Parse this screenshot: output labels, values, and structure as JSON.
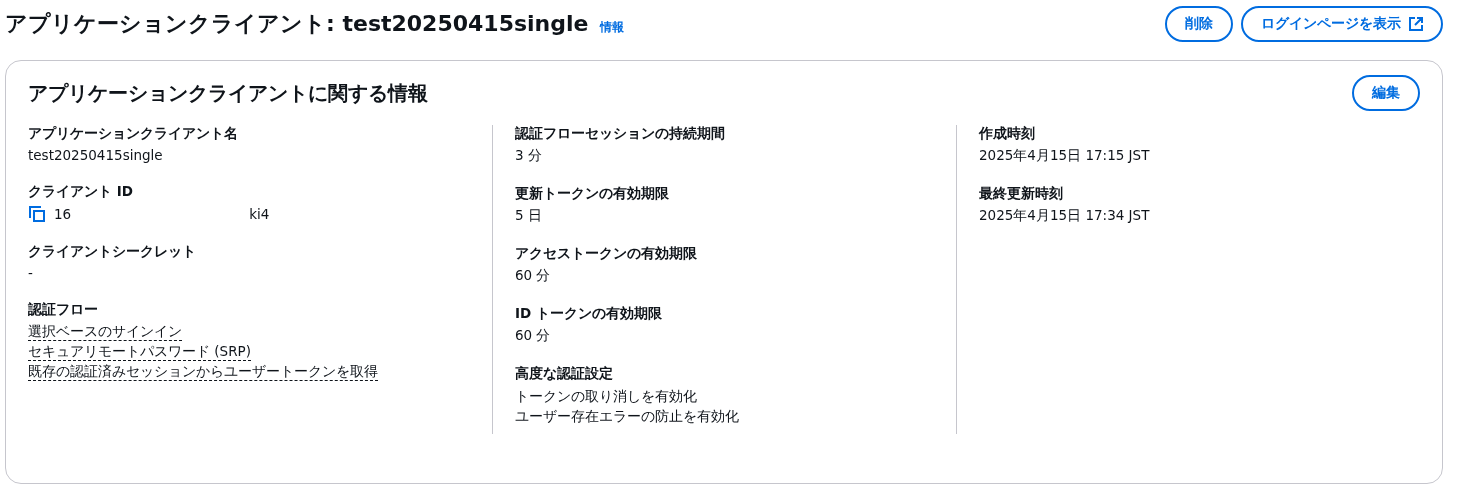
{
  "header": {
    "title": "アプリケーションクライアント: test20250415single",
    "info_link": "情報",
    "buttons": [
      {
        "label": "削除",
        "external": false
      },
      {
        "label": "ログインページを表示",
        "external": true
      }
    ]
  },
  "card": {
    "title": "アプリケーションクライアントに関する情報",
    "edit_button": "編集",
    "columns": [
      {
        "items": [
          {
            "kind": "text",
            "label": "アプリケーションクライアント名",
            "value": "test20250415single"
          },
          {
            "kind": "copy",
            "label": "クライアント ID",
            "value_start": "16",
            "value_end": "ki4"
          },
          {
            "kind": "text",
            "label": "クライアントシークレット",
            "value": "-"
          },
          {
            "kind": "links",
            "label": "認証フロー",
            "values": [
              "選択ベースのサインイン",
              "セキュアリモートパスワード (SRP)",
              "既存の認証済みセッションからユーザートークンを取得"
            ]
          }
        ]
      },
      {
        "items": [
          {
            "kind": "text",
            "label": "認証フローセッションの持続期間",
            "value": "3 分"
          },
          {
            "kind": "text",
            "label": "更新トークンの有効期限",
            "value": "5 日"
          },
          {
            "kind": "text",
            "label": "アクセストークンの有効期限",
            "value": "60 分"
          },
          {
            "kind": "text",
            "label": "ID トークンの有効期限",
            "value": "60 分"
          },
          {
            "kind": "lines",
            "label": "高度な認証設定",
            "values": [
              "トークンの取り消しを有効化",
              "ユーザー存在エラーの防止を有効化"
            ]
          }
        ]
      },
      {
        "items": [
          {
            "kind": "text",
            "label": "作成時刻",
            "value": "2025年4月15日 17:15 JST"
          },
          {
            "kind": "text",
            "label": "最終更新時刻",
            "value": "2025年4月15日 17:34 JST"
          }
        ]
      }
    ]
  }
}
